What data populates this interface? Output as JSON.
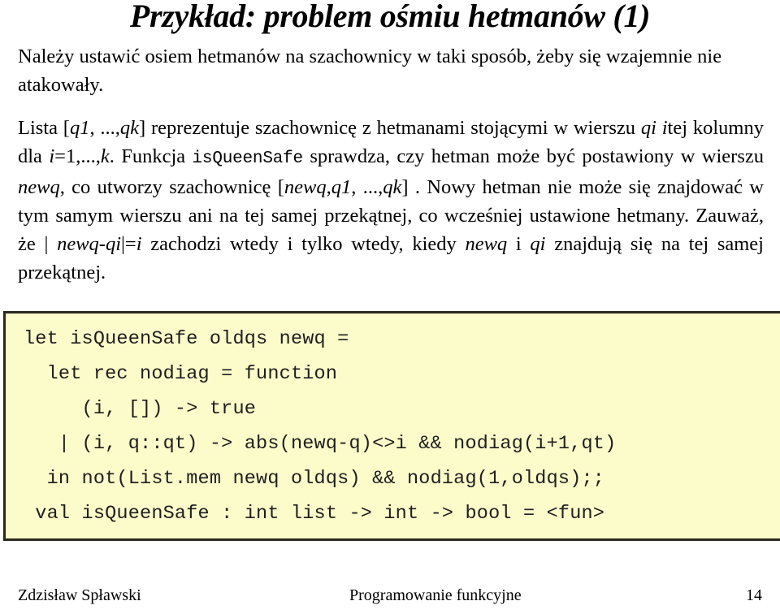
{
  "slide": {
    "title": "Przykład: problem ośmiu hetmanów (1)",
    "page_number": "14"
  },
  "paragraphs": [
    {
      "id": "intro",
      "runs": [
        {
          "text": "Należy ustawić osiem hetmanów na szachownicy w taki sposób, żeby się wzajemnie nie atakowały.",
          "style": "normal"
        }
      ]
    },
    {
      "id": "description",
      "runs": [
        {
          "text": "Lista [",
          "style": "normal"
        },
        {
          "text": "q1",
          "style": "italic"
        },
        {
          "text": ", ...,",
          "style": "normal"
        },
        {
          "text": "qk",
          "style": "italic"
        },
        {
          "text": "] reprezentuje szachownicę z hetmanami stojącymi w wierszu ",
          "style": "normal"
        },
        {
          "text": "qi i",
          "style": "italic"
        },
        {
          "text": "tej kolumny dla ",
          "style": "normal"
        },
        {
          "text": "i",
          "style": "italic"
        },
        {
          "text": "=1,...,",
          "style": "normal"
        },
        {
          "text": "k",
          "style": "italic"
        },
        {
          "text": ". Funkcja ",
          "style": "normal"
        },
        {
          "text": "isQueenSafe",
          "style": "mono"
        },
        {
          "text": " sprawdza, czy hetman może być postawiony w wierszu ",
          "style": "normal"
        },
        {
          "text": "newq",
          "style": "italic"
        },
        {
          "text": ", co utworzy szachownicę [",
          "style": "normal"
        },
        {
          "text": "newq,q1",
          "style": "italic"
        },
        {
          "text": ", ...,",
          "style": "normal"
        },
        {
          "text": "qk",
          "style": "italic"
        },
        {
          "text": "] . Nowy hetman nie może się znajdować w tym samym wierszu ani na tej samej przekątnej, co wcześniej ustawione hetmany. Zauważ, że | ",
          "style": "normal"
        },
        {
          "text": "newq-qi",
          "style": "italic"
        },
        {
          "text": "|=",
          "style": "normal"
        },
        {
          "text": "i",
          "style": "italic"
        },
        {
          "text": " zachodzi wtedy i tylko wtedy, kiedy ",
          "style": "normal"
        },
        {
          "text": "newq",
          "style": "italic"
        },
        {
          "text": " i ",
          "style": "normal"
        },
        {
          "text": "qi",
          "style": "italic"
        },
        {
          "text": " znajdują się na tej samej przekątnej.",
          "style": "normal"
        }
      ]
    }
  ],
  "code_block": {
    "background_color": "#fcfbca",
    "border_color": "#2a2a20",
    "text_color": "#1e1e1e",
    "lines": [
      "let isQueenSafe oldqs newq =",
      "  let rec nodiag = function",
      "     (i, []) -> true",
      "   | (i, q::qt) -> abs(newq-q)<>i && nodiag(i+1,qt)",
      "  in not(List.mem newq oldqs) && nodiag(1,oldqs);;",
      " val isQueenSafe : int list -> int -> bool = <fun>"
    ]
  },
  "footer": {
    "author": "Zdzisław Spławski",
    "course": "Programowanie funkcyjne",
    "page": "14"
  }
}
